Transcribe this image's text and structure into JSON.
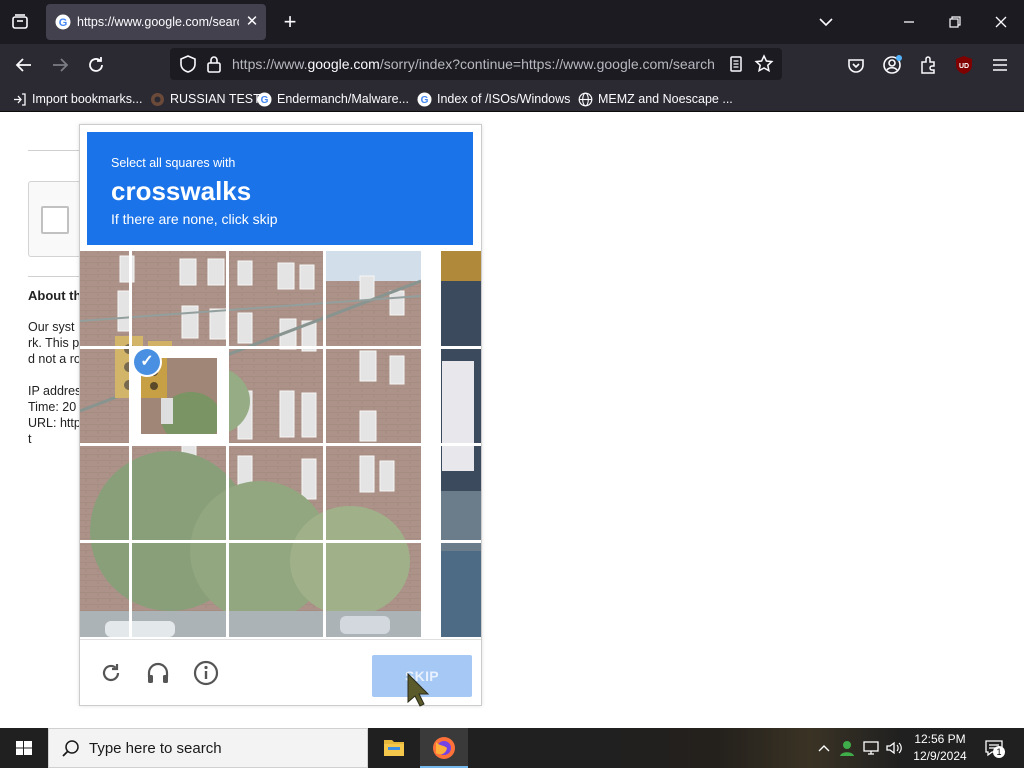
{
  "browser": {
    "tab_title": "https://www.google.com/search?q=",
    "url_prefix": "https://www.",
    "url_domain": "google.com",
    "url_rest": "/sorry/index?continue=https://www.google.com/search",
    "bookmarks": [
      {
        "label": "Import bookmarks...",
        "icon": "import-icon"
      },
      {
        "label": "RUSSIAN TEST",
        "icon": "site-icon"
      },
      {
        "label": "Endermanch/Malware...",
        "icon": "google-icon"
      },
      {
        "label": "Index of /ISOs/Windows",
        "icon": "google-icon"
      },
      {
        "label": "MEMZ and Noescape ...",
        "icon": "globe-icon"
      }
    ],
    "colors": {
      "tabbar": "#1c1b22",
      "navbar": "#2b2a33",
      "urlbar": "#1c1b22"
    }
  },
  "page": {
    "about_heading": "About th",
    "lines": [
      "Our syst",
      "rk. This p",
      "d not a ro",
      "IP addres",
      "Time: 20",
      "URL: http",
      "t"
    ]
  },
  "captcha": {
    "instruction_small": "Select all squares with",
    "instruction_target": "crosswalks",
    "instruction_hint": "If there are none, click skip",
    "skip_label": "SKIP",
    "selected_tiles": 1,
    "colors": {
      "header": "#1a73e8",
      "skip_button": "#a5c8f4",
      "check_badge": "#4a90e2"
    }
  },
  "taskbar": {
    "search_placeholder": "Type here to search",
    "time": "12:56 PM",
    "date": "12/9/2024",
    "notification_count": "1"
  }
}
